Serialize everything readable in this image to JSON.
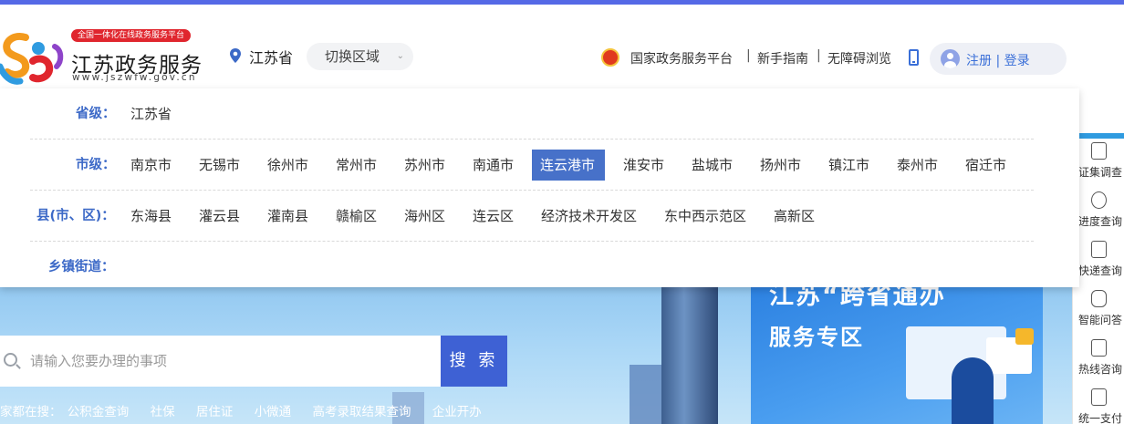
{
  "header": {
    "badge": "全国一体化在线政务服务平台",
    "title": "江苏政务服务",
    "url": "www.jszwfw.gov.cn",
    "location": "江苏省",
    "region_button": "切换区域",
    "nav": {
      "national": "国家政务服务平台",
      "sep1": "|",
      "guide": "新手指南",
      "sep2": "|",
      "accessible": "无障碍浏览"
    },
    "login": "注册 | 登录"
  },
  "region_dropdown": {
    "province": {
      "label": "省级：",
      "items": [
        "江苏省"
      ]
    },
    "city": {
      "label": "市级：",
      "items": [
        "南京市",
        "无锡市",
        "徐州市",
        "常州市",
        "苏州市",
        "南通市",
        "连云港市",
        "淮安市",
        "盐城市",
        "扬州市",
        "镇江市",
        "泰州市",
        "宿迁市"
      ],
      "selected": "连云港市"
    },
    "county": {
      "label": "县(市、区)：",
      "items": [
        "东海县",
        "灌云县",
        "灌南县",
        "赣榆区",
        "海州区",
        "连云区",
        "经济技术开发区",
        "东中西示范区",
        "高新区"
      ]
    },
    "town": {
      "label": "乡镇街道：",
      "items": []
    }
  },
  "search": {
    "placeholder": "请输入您要办理的事项",
    "button": "搜 索",
    "hot_prefix": "家都在搜：",
    "hot_items": [
      "公积金查询",
      "社保",
      "居住证",
      "小微通",
      "高考录取结果查询",
      "企业开办"
    ]
  },
  "promo": {
    "title": "江苏“跨省通办",
    "subtitle": "服务专区"
  },
  "side_toolbar": {
    "items": [
      "证集调查",
      "进度查询",
      "快递查询",
      "智能问答",
      "热线咨询",
      "统一支付"
    ]
  },
  "colors": {
    "accent": "#5569e6",
    "primary_blue": "#4771c9",
    "label_blue": "#3c69c7",
    "search_button": "#3e61d4",
    "badge_red": "#e0262e"
  }
}
